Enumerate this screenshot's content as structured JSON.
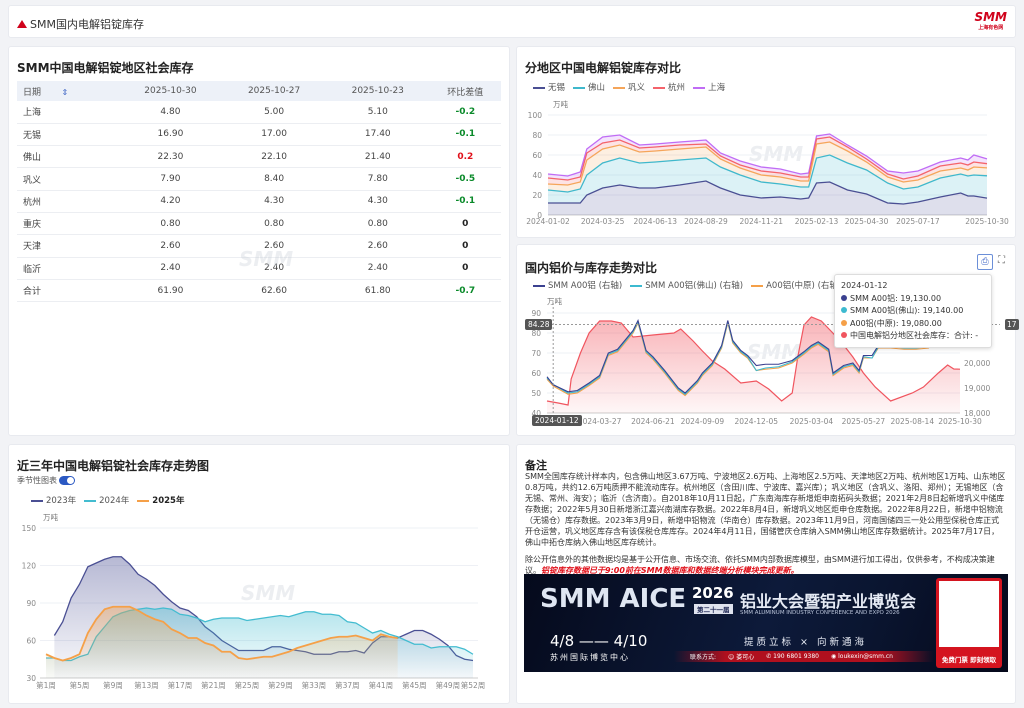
{
  "header": {
    "title": "SMM国内电解铝锭库存",
    "logo": "SMM",
    "logo_sub": "上海有色网"
  },
  "watermark": "SMM",
  "table": {
    "title": "SMM中国电解铝锭地区社会库存",
    "columns": [
      "日期",
      "2025-10-30",
      "2025-10-27",
      "2025-10-23",
      "环比差值"
    ],
    "rows": [
      {
        "region": "上海",
        "v": [
          "4.80",
          "5.00",
          "5.10"
        ],
        "diff": "-0.2",
        "dir": "down"
      },
      {
        "region": "无锡",
        "v": [
          "16.90",
          "17.00",
          "17.40"
        ],
        "diff": "-0.1",
        "dir": "down"
      },
      {
        "region": "佛山",
        "v": [
          "22.30",
          "22.10",
          "21.40"
        ],
        "diff": "0.2",
        "dir": "up"
      },
      {
        "region": "巩义",
        "v": [
          "7.90",
          "8.40",
          "7.80"
        ],
        "diff": "-0.5",
        "dir": "down"
      },
      {
        "region": "杭州",
        "v": [
          "4.20",
          "4.30",
          "4.30"
        ],
        "diff": "-0.1",
        "dir": "down"
      },
      {
        "region": "重庆",
        "v": [
          "0.80",
          "0.80",
          "0.80"
        ],
        "diff": "0",
        "dir": "flat"
      },
      {
        "region": "天津",
        "v": [
          "2.60",
          "2.60",
          "2.60"
        ],
        "diff": "0",
        "dir": "flat"
      },
      {
        "region": "临沂",
        "v": [
          "2.40",
          "2.40",
          "2.40"
        ],
        "diff": "0",
        "dir": "flat"
      },
      {
        "region": "合计",
        "v": [
          "61.90",
          "62.60",
          "61.80"
        ],
        "diff": "-0.7",
        "dir": "down"
      }
    ],
    "colors": {
      "up": "#e0101a",
      "down": "#0a8a2a",
      "flat": "#222222"
    }
  },
  "notes": {
    "title": "备注",
    "p1": "SMM全国库存统计样本内，包含佛山地区3.67万吨、宁波地区2.6万吨、上海地区2.5万吨、天津地区2万吨、杭州地区1万吨、山东地区0.8万吨，共约12.6万吨质押不能流动库存。杭州地区（含田川库、宁波库、嘉兴库）；巩义地区（含巩义、洛阳、郑州）；无锡地区（含无锡、常州、海安）；临沂（含济南）。自2018年10月11日起，广东南海库存新增炬申南拓码头数据；2021年2月8日起新增巩义中储库存数据；2022年5月30日新增浙江嘉兴南湖库存数据。2022年8月4日，新增巩义地区炬申仓库数据。2022年8月22日，新增中铝物流（无锡仓）库存数据。2023年3月9日，新增中铝物流（华南仓）库存数据。2023年11月9日，河南国储四三一处公用型保税仓库正式开仓运营，巩义地区库存含有该保税仓库库存。2024年4月11日，国储管庆仓库纳入SMM佛山地区库存数据统计。2025年7月17日，佛山中拓仓库纳入佛山地区库存统计。",
    "p2": "除公开信息外的其他数据均是基于公开信息、市场交流、依托SMM内部数据库模型，由SMM进行加工得出，仅供参考，不构成决策建议。",
    "p2_highlight": "铝锭库存数据已于9:00前在SMM数据库和数据终端分析模块完成更新。"
  },
  "banner": {
    "brand": "SMM AICE",
    "year": "2026",
    "edition": "第二十一届",
    "cn_title": "铝业大会暨铝产业博览会",
    "en_title": "SMM ALUMINUM INDUSTRY CONFERENCE AND EXPO 2026",
    "dates": "4/8 —— 4/10",
    "venue": "苏州国际博览中心",
    "slogan": "提质立标 × 向新通海",
    "contact_label": "联系方式:",
    "contact_name": "娄可心",
    "phone": "190 6801 9380",
    "email": "loukexin@smm.cn",
    "qr_cta": "免费门票 即刻领取"
  },
  "chart_data": [
    {
      "type": "area",
      "stacked": true,
      "title": "分地区中国电解铝锭库存对比",
      "ylabel": "万吨",
      "ylim": [
        0,
        100
      ],
      "yticks": [
        0,
        20,
        40,
        60,
        80,
        100
      ],
      "grid": true,
      "legend": "top-left",
      "xticks": [
        "2024-01-02",
        "2024-03-25",
        "2024-06-13",
        "2024-08-29",
        "2024-11-21",
        "2025-02-13",
        "2025-04-30",
        "2025-07-17",
        "2025-10-30"
      ],
      "x": [
        "2024-01-02",
        "2024-02-01",
        "2024-02-20",
        "2024-03-01",
        "2024-03-25",
        "2024-04-20",
        "2024-05-20",
        "2024-06-13",
        "2024-07-20",
        "2024-08-29",
        "2024-09-20",
        "2024-10-20",
        "2024-11-21",
        "2024-12-20",
        "2025-01-20",
        "2025-02-01",
        "2025-02-13",
        "2025-03-05",
        "2025-04-01",
        "2025-04-30",
        "2025-06-01",
        "2025-06-25",
        "2025-07-17",
        "2025-08-20",
        "2025-09-20",
        "2025-10-01",
        "2025-10-10",
        "2025-10-30"
      ],
      "series": [
        {
          "name": "无锡",
          "color": "#4a4f93",
          "values": [
            12,
            12,
            12,
            20,
            27,
            30,
            27,
            27,
            30,
            34,
            27,
            20,
            17,
            18,
            16,
            17,
            32,
            33,
            25,
            21,
            12,
            11,
            13,
            18,
            22,
            19,
            19,
            16.9
          ]
        },
        {
          "name": "佛山",
          "color": "#3fb8cc",
          "values": [
            13,
            11,
            14,
            20,
            25,
            27,
            25,
            26,
            25,
            23,
            21,
            20,
            16,
            13,
            12,
            11,
            25,
            27,
            27,
            24,
            20,
            15,
            15,
            19,
            19,
            20,
            21,
            22.3
          ]
        },
        {
          "name": "巩义",
          "color": "#f5a55a",
          "values": [
            6,
            7,
            7,
            15,
            14,
            13,
            11,
            11,
            11,
            11,
            8,
            7,
            7,
            7,
            6,
            6,
            14,
            13,
            12,
            8,
            6,
            7,
            7,
            7,
            6,
            6,
            8,
            7.9
          ]
        },
        {
          "name": "杭州",
          "color": "#f4636b",
          "values": [
            6,
            5,
            5,
            7,
            6,
            5,
            4,
            4,
            4,
            3,
            3,
            3,
            4,
            4,
            4,
            4,
            5,
            5,
            4,
            3,
            3,
            3,
            4,
            5,
            5,
            5,
            5,
            4.2
          ]
        },
        {
          "name": "上海",
          "color": "#c06cf5",
          "values": [
            4,
            4,
            5,
            4,
            6,
            5,
            3,
            3,
            3,
            4,
            3,
            4,
            4,
            4,
            3,
            4,
            3,
            3,
            2,
            3,
            3,
            6,
            5,
            4,
            5,
            5,
            7,
            4.8
          ]
        }
      ]
    },
    {
      "type": "line",
      "title": "国内铝价与库存走势对比",
      "ylabel": "万吨",
      "ylim": [
        40,
        90
      ],
      "yticks": [
        40,
        50,
        60,
        70,
        80,
        90
      ],
      "y2lim": [
        18000,
        22000
      ],
      "y2ticks": [
        "18,000",
        "19,000",
        "20,000"
      ],
      "grid": true,
      "legend": "top-left",
      "xticks": [
        "2024-03-27",
        "2024-06-21",
        "2024-09-09",
        "2024-12-05",
        "2025-03-04",
        "2025-05-27",
        "2025-08-14",
        "2025-10-30"
      ],
      "crosshair": {
        "x": "2024-01-12",
        "y": "84.28",
        "y2": "17"
      },
      "tooltip": {
        "date": "2024-01-12",
        "items": [
          {
            "name": "SMM A00铝",
            "value": "19,130.00"
          },
          {
            "name": "SMM A00铝(佛山)",
            "value": "19,140.00"
          },
          {
            "name": "A00铝(中原)",
            "value": "19,080.00"
          },
          {
            "name": "中国电解铝分地区社会库存：合计",
            "value": "-"
          }
        ]
      },
      "price_x": [
        "2024-01-02",
        "2024-01-12",
        "2024-02-05",
        "2024-02-20",
        "2024-03-10",
        "2024-03-27",
        "2024-04-10",
        "2024-04-25",
        "2024-05-20",
        "2024-05-28",
        "2024-06-10",
        "2024-06-21",
        "2024-07-10",
        "2024-08-01",
        "2024-08-12",
        "2024-09-01",
        "2024-09-09",
        "2024-09-25",
        "2024-10-10",
        "2024-10-20",
        "2024-10-28",
        "2024-11-10",
        "2024-11-21",
        "2024-12-05",
        "2024-12-20",
        "2025-01-10",
        "2025-02-01",
        "2025-02-20",
        "2025-03-04",
        "2025-03-15",
        "2025-04-01",
        "2025-04-08",
        "2025-04-25",
        "2025-05-10",
        "2025-05-20",
        "2025-05-27",
        "2025-06-10",
        "2025-06-20",
        "2025-07-10",
        "2025-08-01",
        "2025-08-20",
        "2025-09-10"
      ],
      "series": [
        {
          "name": "SMM A00铝 (右轴)",
          "axis": "right",
          "color": "#3b4190",
          "values": [
            19450,
            19130,
            18850,
            18900,
            19200,
            19500,
            20400,
            20550,
            21300,
            21700,
            20500,
            20250,
            19700,
            19000,
            18800,
            19300,
            19600,
            20000,
            20700,
            21700,
            20900,
            20500,
            20300,
            19900,
            19950,
            19950,
            20100,
            20450,
            20700,
            20850,
            20550,
            19600,
            19900,
            20000,
            19700,
            20300,
            20300,
            20700,
            20700,
            20650,
            20650,
            20700
          ]
        },
        {
          "name": "SMM A00铝(佛山) (右轴)",
          "axis": "right",
          "color": "#3cbad0",
          "values": [
            19400,
            19140,
            18800,
            18850,
            19150,
            19450,
            20350,
            20500,
            21250,
            21650,
            20450,
            20200,
            19650,
            18950,
            18750,
            19250,
            19550,
            19950,
            20650,
            21650,
            20850,
            20450,
            20250,
            19700,
            19800,
            19850,
            20050,
            20400,
            20650,
            20800,
            20500,
            19550,
            19850,
            19950,
            19650,
            20250,
            20200,
            20650,
            20650,
            20600,
            20600,
            20650
          ]
        },
        {
          "name": "A00铝(中原) (右轴)",
          "axis": "right",
          "color": "#f5a048",
          "values": [
            19350,
            19080,
            18750,
            18800,
            19100,
            19400,
            20300,
            20450,
            21200,
            21600,
            20400,
            20150,
            19600,
            18900,
            18700,
            19200,
            19500,
            19900,
            20600,
            21600,
            20800,
            20400,
            20200,
            19700,
            19750,
            19800,
            20000,
            20350,
            20600,
            20750,
            20450,
            19500,
            19800,
            19900,
            19600,
            20200,
            20200,
            20600,
            20600,
            20550,
            20550,
            20600
          ]
        },
        {
          "name": "中国电解铝分地区社会库存：合计",
          "axis": "left",
          "color": "#f0555f",
          "x": [
            "2024-01-02",
            "2024-01-20",
            "2024-02-05",
            "2024-02-10",
            "2024-02-25",
            "2024-03-10",
            "2024-03-27",
            "2024-04-15",
            "2024-05-01",
            "2024-05-20",
            "2024-06-21",
            "2024-07-25",
            "2024-08-05",
            "2024-08-25",
            "2024-09-09",
            "2024-09-25",
            "2024-10-15",
            "2024-11-10",
            "2024-12-05",
            "2024-12-25",
            "2025-01-15",
            "2025-02-01",
            "2025-02-10",
            "2025-02-20",
            "2025-03-04",
            "2025-03-20",
            "2025-04-20",
            "2025-05-10",
            "2025-05-27",
            "2025-06-15",
            "2025-07-10",
            "2025-08-14",
            "2025-09-01",
            "2025-09-25",
            "2025-10-10",
            "2025-10-20",
            "2025-10-30"
          ],
          "values": [
            46,
            45,
            44,
            57,
            70,
            80,
            86,
            86,
            85,
            78,
            79,
            80,
            82,
            76,
            71,
            66,
            62,
            55,
            56,
            52,
            46,
            50,
            68,
            84,
            88,
            86,
            76,
            68,
            60,
            53,
            46,
            50,
            53,
            60,
            64,
            62,
            61.9
          ]
        }
      ]
    },
    {
      "type": "area",
      "title": "近三年中国电解铝锭社会库存走势图",
      "ylabel": "万吨",
      "ylim": [
        30,
        150
      ],
      "yticks": [
        30,
        60,
        90,
        120,
        150
      ],
      "grid": true,
      "legend": "top-left",
      "toggle_label": "季节性图表",
      "toggle_on": true,
      "xticks": [
        "第1周",
        "第5周",
        "第9周",
        "第13周",
        "第17周",
        "第21周",
        "第25周",
        "第29周",
        "第33周",
        "第37周",
        "第41周",
        "第45周",
        "第49周",
        "第52周"
      ],
      "series": [
        {
          "name": "2023年",
          "color": "#4a4f93",
          "values": [
            null,
            64,
            75,
            94,
            105,
            119,
            122,
            125,
            127,
            127,
            121,
            113,
            109,
            104,
            97,
            91,
            86,
            84,
            79,
            71,
            66,
            60,
            56,
            52,
            52,
            52,
            52,
            55,
            55,
            53,
            52,
            51,
            49,
            49,
            49,
            51,
            51,
            52,
            50,
            58,
            63,
            63,
            62,
            65,
            68,
            68,
            65,
            61,
            56,
            48,
            45,
            44
          ]
        },
        {
          "name": "2024年",
          "color": "#43bcd0",
          "values": [
            46,
            46,
            44,
            44,
            47,
            49,
            63,
            71,
            79,
            82,
            84,
            85,
            86,
            85,
            86,
            85,
            81,
            80,
            78,
            75,
            77,
            78,
            78,
            78,
            76,
            77,
            78,
            79,
            80,
            79,
            81,
            83,
            83,
            81,
            81,
            80,
            75,
            74,
            70,
            66,
            68,
            65,
            63,
            60,
            57,
            57,
            54,
            55,
            55,
            55,
            53,
            49
          ]
        },
        {
          "name": "2025年",
          "color": "#f5a048",
          "bold": true,
          "values": [
            49,
            46,
            44,
            46,
            49,
            66,
            77,
            85,
            87,
            87,
            87,
            84,
            80,
            77,
            75,
            69,
            66,
            62,
            62,
            58,
            56,
            51,
            51,
            46,
            45,
            46,
            47,
            47,
            49,
            51,
            54,
            56,
            58,
            60,
            62,
            63,
            63,
            64,
            62,
            60,
            65,
            63,
            61.9
          ]
        }
      ]
    }
  ]
}
